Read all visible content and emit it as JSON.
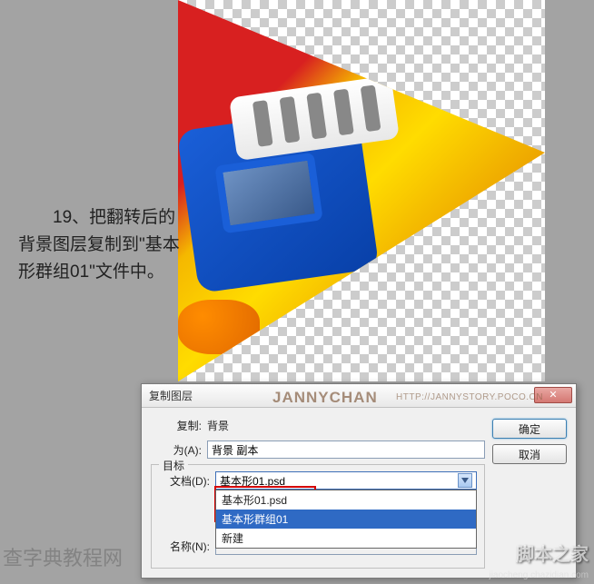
{
  "instruction": "　　19、把翻转后的背景图层复制到\"基本形群组01\"文件中。",
  "dialog": {
    "title": "复制图层",
    "copy_label": "复制:",
    "copy_value": "背景",
    "as_label": "为(A):",
    "as_value": "背景 副本",
    "target_legend": "目标",
    "document_label": "文档(D):",
    "document_value": "基本形01.psd",
    "name_label": "名称(N):",
    "name_value": "",
    "options": [
      "基本形01.psd",
      "基本形群组01",
      "新建"
    ],
    "ok": "确定",
    "cancel": "取消",
    "close_x": "✕"
  },
  "watermarks": {
    "brand": "JANNYCHAN",
    "url": "HTTP://JANNYSTORY.POCO.CN",
    "bottom_left": "查字典教程网",
    "bottom_right": "脚本之家",
    "bottom_sub": "jiaocheng.chazidian.com"
  }
}
